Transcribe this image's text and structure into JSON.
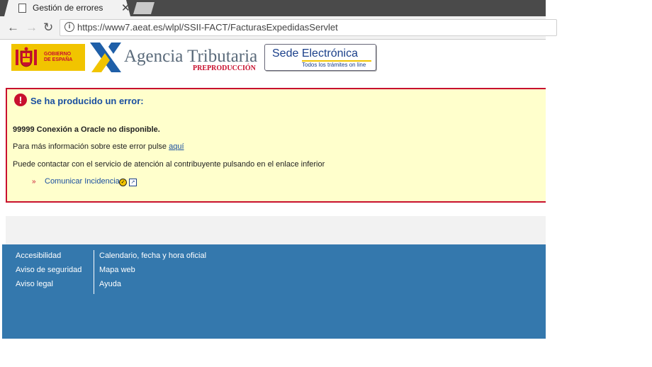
{
  "browser": {
    "tab_title": "Gestión de errores",
    "tab_close": "✕",
    "url": "https://www7.aeat.es/wlpl/SSII-FACT/FacturasExpedidasServlet"
  },
  "header": {
    "gobierno_line1": "GOBIERNO",
    "gobierno_line2": "DE ESPAÑA",
    "agency_name": "Agencia Tributaria",
    "environment": "PREPRODUCCIÓN",
    "sede_title": "Sede Electrónica",
    "sede_subtitle": "Todos los trámites on line"
  },
  "error": {
    "title": "Se ha producido un error:",
    "message": "99999 Conexión a Oracle no disponible.",
    "more_info_text": "Para más información sobre este error pulse",
    "more_info_link": "aquí",
    "contact_text": "Puede contactar con el servicio de atención al contribuyente pulsando en el enlace inferior",
    "report_link": "Comunicar Incidencia"
  },
  "footer": {
    "col1": [
      "Accesibilidad",
      "Aviso de seguridad",
      "Aviso legal"
    ],
    "col2": [
      "Calendario, fecha y hora oficial",
      "Mapa web",
      "Ayuda"
    ]
  },
  "colors": {
    "error_border": "#c8102e",
    "error_background": "#ffffcc",
    "footer_background": "#3478ad",
    "link": "#1a4fa0"
  }
}
